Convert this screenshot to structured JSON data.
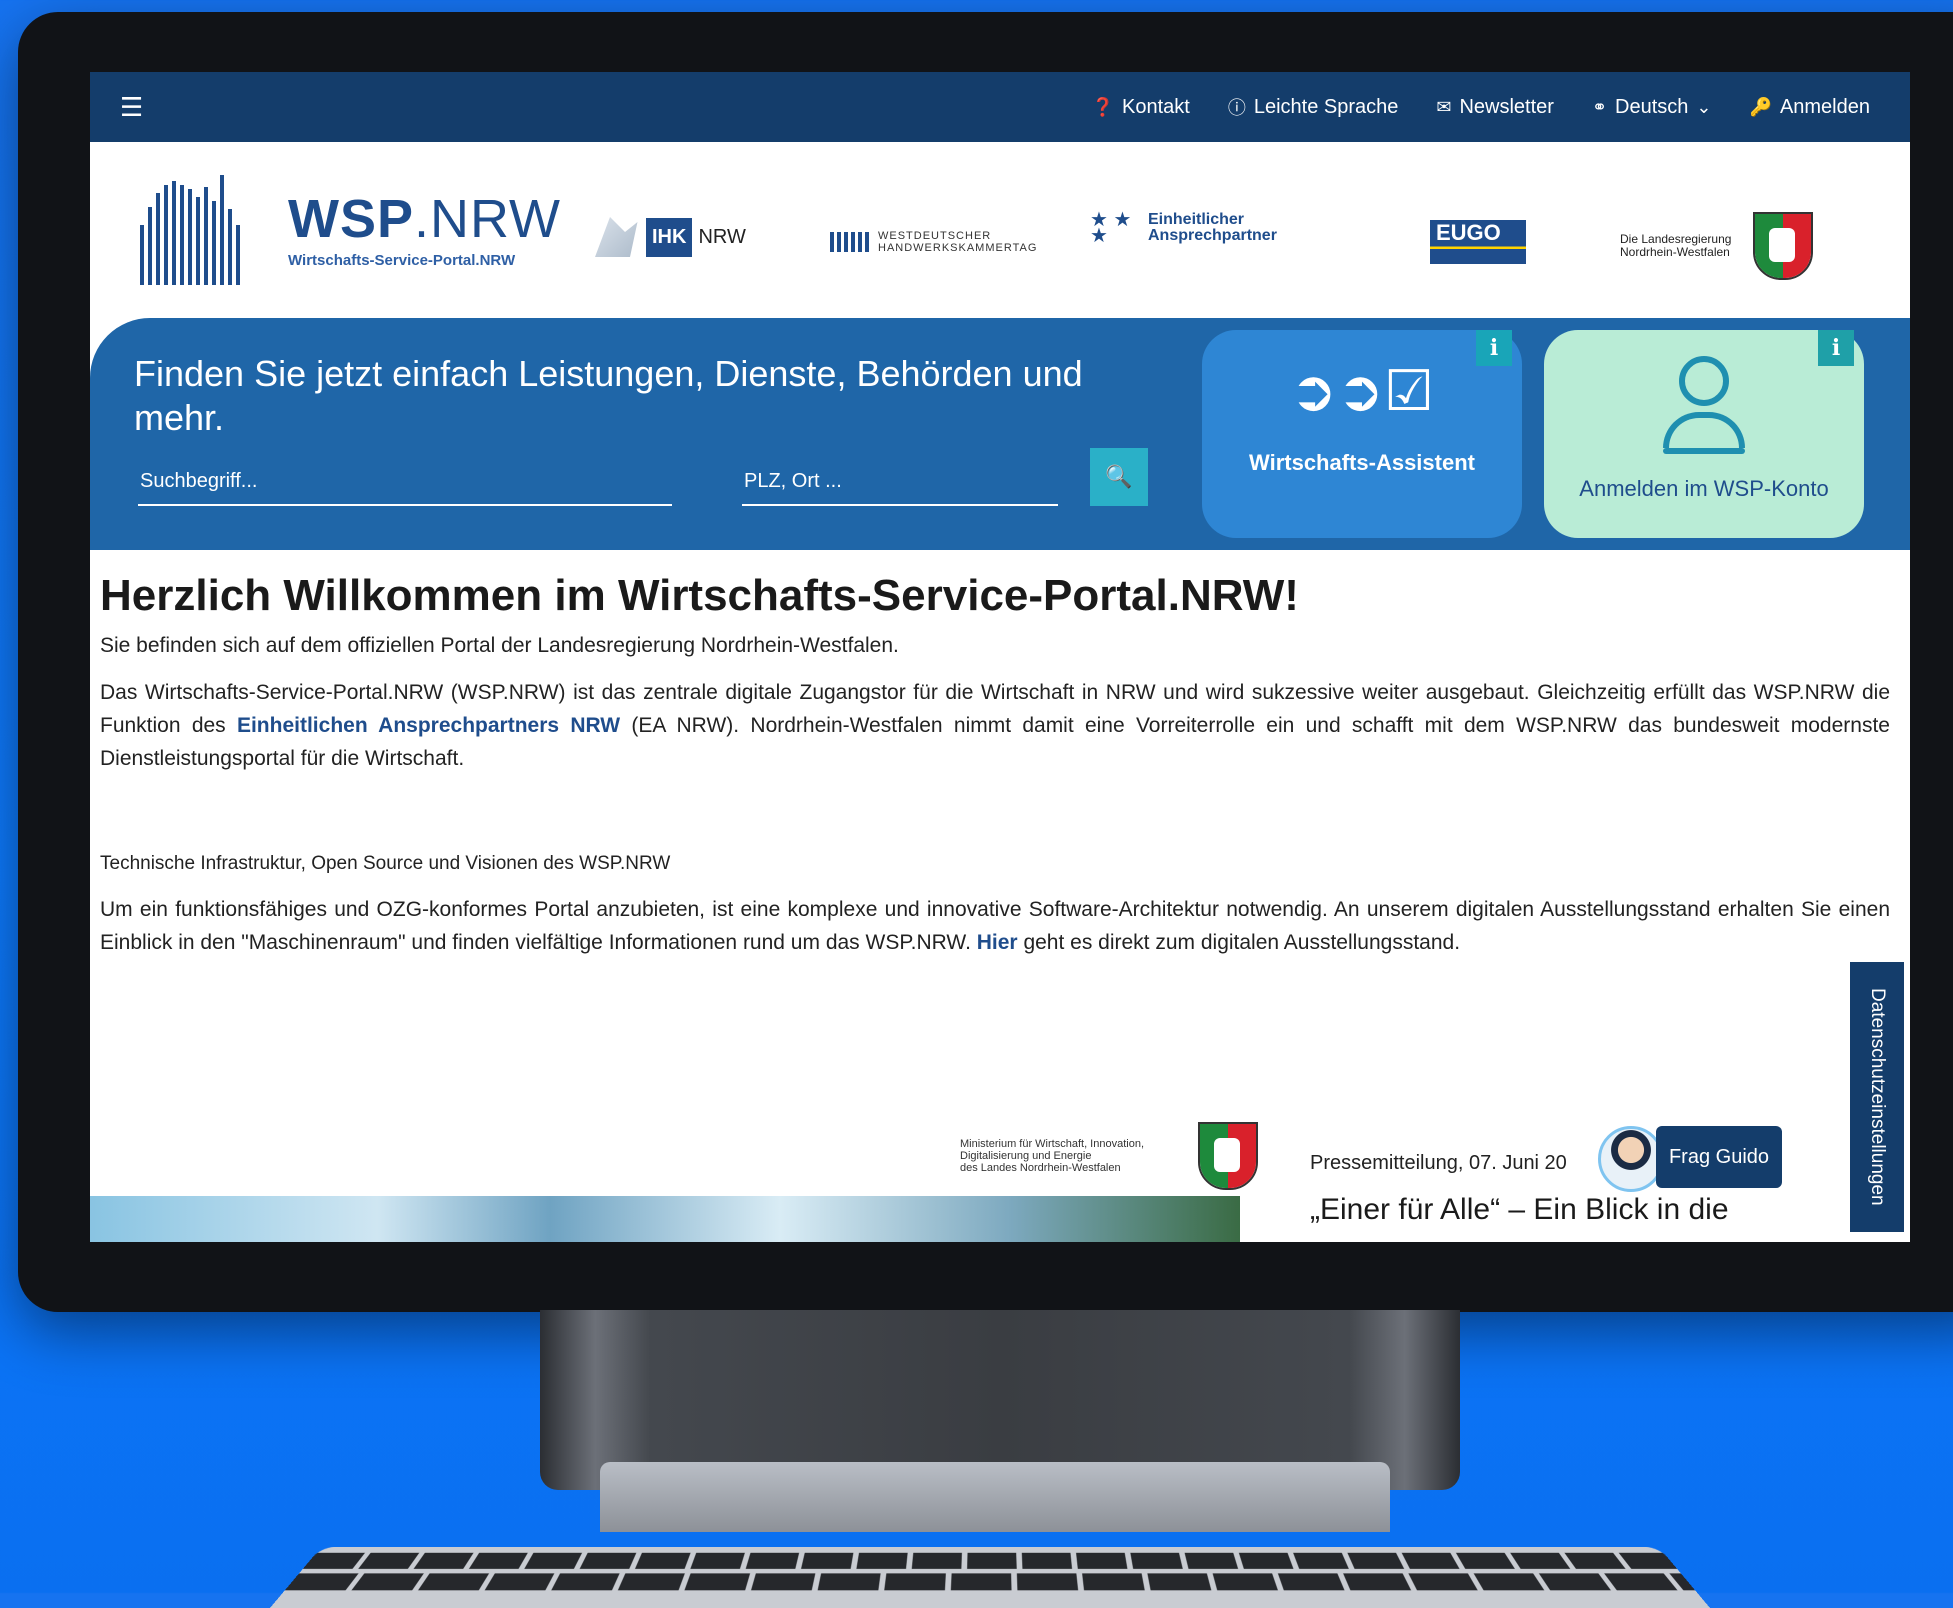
{
  "topnav": {
    "menu_icon": "hamburger-icon",
    "links": [
      {
        "icon": "question-circle-icon",
        "label": "Kontakt"
      },
      {
        "icon": "info-circle-icon",
        "label": "Leichte Sprache"
      },
      {
        "icon": "envelope-icon",
        "label": "Newsletter"
      },
      {
        "icon": "globe-icon",
        "label": "Deutsch"
      },
      {
        "icon": "key-icon",
        "label": "Anmelden"
      }
    ]
  },
  "logos": {
    "wsp_title_bold": "WSP",
    "wsp_title_light": ".NRW",
    "wsp_subtitle": "Wirtschafts-Service-Portal.NRW",
    "ihk_box": "IHK",
    "ihk_text": "NRW",
    "whkt_line1": "WESTDEUTSCHER",
    "whkt_line2": "HANDWERKSKAMMERTAG",
    "eap_line1": "Einheitlicher",
    "eap_line2": "Ansprechpartner",
    "eugo": "EUGO",
    "lreg_line1": "Die Landesregierung",
    "lreg_line2": "Nordrhein-Westfalen"
  },
  "hero": {
    "title": "Finden Sie jetzt einfach Leistungen, Dienste, Behörden und mehr.",
    "search_placeholder": "Suchbegriff...",
    "plz_placeholder": "PLZ, Ort ...",
    "search_icon": "search-icon",
    "tile_assist_label": "Wirtschafts-Assistent",
    "tile_login_label": "Anmelden im WSP-Konto",
    "info_label": "i"
  },
  "content": {
    "heading": "Herzlich Willkommen im Wirtschafts-Service-Portal.NRW!",
    "lead": "Sie befinden sich auf dem offiziellen Portal der Landesregierung Nordrhein-Westfalen.",
    "para1_a": "Das Wirtschafts-Service-Portal.NRW (WSP.NRW) ist das zentrale digitale Zugangstor für die Wirtschaft in NRW und wird sukzessive weiter ausgebaut. Gleichzeitig erfüllt das WSP.NRW die Funktion des ",
    "para1_link": "Einheitlichen Ansprechpartners NRW",
    "para1_b": " (EA NRW). Nordrhein-Westfalen nimmt damit eine Vorreiterrolle ein und schafft mit dem WSP.NRW das bundesweit modernste Dienstleistungsportal für die Wirtschaft.",
    "subhead": "Technische Infrastruktur, Open Source und Visionen des WSP.NRW",
    "para2_a": "Um ein funktionsfähiges und OZG-konformes Portal anzubieten, ist eine komplexe und innovative Software-Architektur notwendig. An unserem digitalen Ausstellungsstand erhalten Sie einen Einblick in den \"Maschinenraum\" und finden vielfältige Informationen rund um das WSP.NRW. ",
    "para2_link": "Hier",
    "para2_b": " geht es direkt zum digitalen Ausstellungsstand."
  },
  "footer_area": {
    "ministry_line1": "Ministerium für Wirtschaft, Innovation,",
    "ministry_line2": "Digitalisierung und Energie",
    "ministry_line3": "des Landes Nordrhein-Westfalen",
    "press_date": "Pressemitteilung, 07. Juni 20",
    "guido_button": "Frag Guido",
    "press_title": "„Einer für Alle“ – Ein Blick in die",
    "privacy_tab": "Datenschutzeinstellungen"
  }
}
